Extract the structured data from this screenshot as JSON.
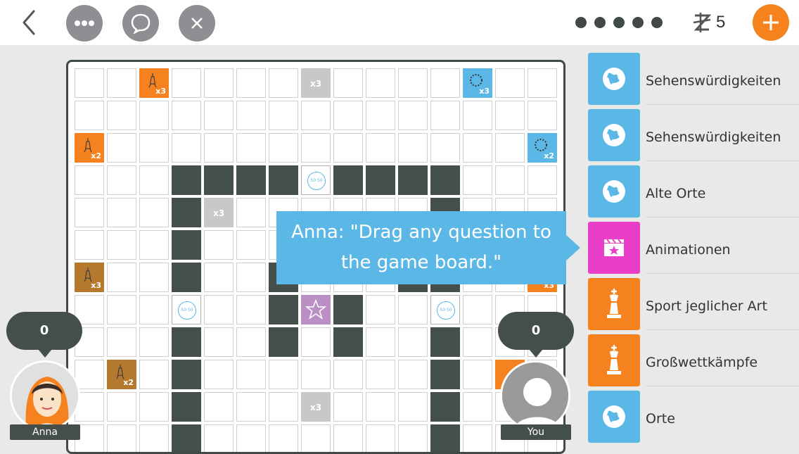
{
  "topbar": {
    "coin_count": "5",
    "round_dots": 5
  },
  "tooltip": {
    "line1": "Anna: \"Drag any question to",
    "line2": "the game board.\""
  },
  "categories": [
    {
      "label": "Sehenswürdigkeiten",
      "color": "#5bb8e6",
      "icon": "globe-icon"
    },
    {
      "label": "Sehenswürdigkeiten",
      "color": "#5bb8e6",
      "icon": "globe-icon"
    },
    {
      "label": "Alte Orte",
      "color": "#5bb8e6",
      "icon": "globe-icon"
    },
    {
      "label": "Animationen",
      "color": "#e83ec8",
      "icon": "film-clapper-icon"
    },
    {
      "label": "Sport jeglicher Art",
      "color": "#f5821f",
      "icon": "chess-king-icon"
    },
    {
      "label": "Großwettkämpfe",
      "color": "#f5821f",
      "icon": "chess-king-icon"
    },
    {
      "label": "Orte",
      "color": "#5bb8e6",
      "icon": "globe-icon"
    }
  ],
  "players": {
    "left": {
      "name": "Anna",
      "score": "0"
    },
    "right": {
      "name": "You",
      "score": "0"
    }
  },
  "board": {
    "multipliers": {
      "x3": "x3",
      "x2": "x2"
    },
    "joker_label": "50 50"
  },
  "colors": {
    "accent_orange": "#f5821f",
    "accent_blue": "#5bb8e6",
    "dark": "#444f49",
    "magenta": "#e83ec8"
  }
}
